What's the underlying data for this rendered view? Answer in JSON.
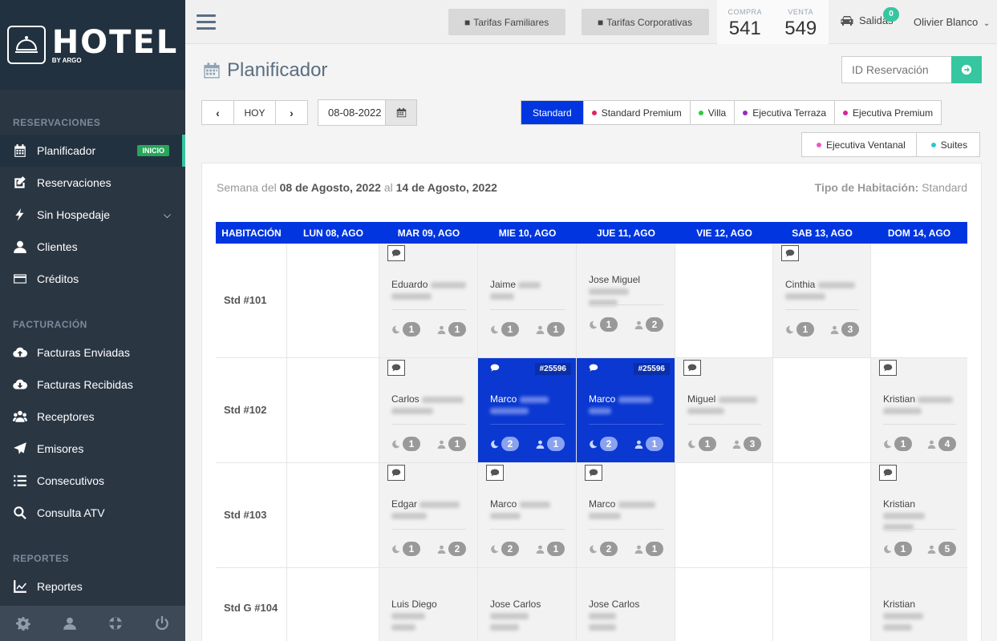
{
  "sidebar": {
    "logo": {
      "name": "HOTEL",
      "sub": "BY ARGO"
    },
    "sections": {
      "reservaciones": "RESERVACIONES",
      "facturacion": "FACTURACIÓN",
      "reportes": "REPORTES"
    },
    "items": [
      {
        "label": "Planificador",
        "icon": "calendar-icon",
        "badge": "INICIO"
      },
      {
        "label": "Reservaciones",
        "icon": "edit-icon"
      },
      {
        "label": "Sin Hospedaje",
        "icon": "bolt-icon"
      },
      {
        "label": "Clientes",
        "icon": "user-icon"
      },
      {
        "label": "Créditos",
        "icon": "credit-card-icon"
      },
      {
        "label": "Facturas Enviadas",
        "icon": "cloud-upload-icon"
      },
      {
        "label": "Facturas Recibidas",
        "icon": "cloud-download-icon"
      },
      {
        "label": "Receptores",
        "icon": "users-icon"
      },
      {
        "label": "Emisores",
        "icon": "paper-plane-icon"
      },
      {
        "label": "Consecutivos",
        "icon": "list-icon"
      },
      {
        "label": "Consulta ATV",
        "icon": "search-icon"
      },
      {
        "label": "Reportes",
        "icon": "line-chart-icon"
      }
    ]
  },
  "topbar": {
    "btn_familiares": "Tarifas Familiares",
    "btn_corporativas": "Tarifas Corporativas",
    "compra_label": "COMPRA",
    "compra_value": "541",
    "venta_label": "VENTA",
    "venta_value": "549",
    "salidas_label": "Salidas",
    "salidas_count": "0",
    "user_name": "Olivier Blanco"
  },
  "page": {
    "title": "Planificador",
    "search_placeholder": "ID Reservación",
    "today_label": "HOY",
    "date_value": "08-08-2022"
  },
  "room_types": [
    {
      "label": "Standard",
      "color": "",
      "active": true
    },
    {
      "label": "Standard Premium",
      "color": "#e0245e"
    },
    {
      "label": "Villa",
      "color": "#2ecc40"
    },
    {
      "label": "Ejecutiva Terraza",
      "color": "#9b27c2"
    },
    {
      "label": "Ejecutiva Premium",
      "color": "#d6249f"
    },
    {
      "label": "Ejecutiva Ventanal",
      "color": "#e85ac8"
    },
    {
      "label": "Suites",
      "color": "#2ec7d3"
    }
  ],
  "week": {
    "prefix": "Semana del",
    "start": "08 de Agosto, 2022",
    "mid": "al",
    "end": "14 de Agosto, 2022",
    "tipo_label": "Tipo de Habitación:",
    "tipo_value": "Standard"
  },
  "grid": {
    "headers": [
      "HABITACIÓN",
      "LUN 08, AGO",
      "MAR 09, AGO",
      "MIE 10, AGO",
      "JUE 11, AGO",
      "VIE 12, AGO",
      "SAB 13, AGO",
      "DOM 14, AGO"
    ],
    "rows": [
      {
        "room": "Std #101",
        "cells": [
          null,
          {
            "name": "Eduardo",
            "nights": "1",
            "guests": "1"
          },
          {
            "name": "Jaime",
            "nights": "1",
            "guests": "1"
          },
          {
            "name": "Jose Miguel",
            "nights": "1",
            "guests": "2"
          },
          null,
          {
            "name": "Cinthia",
            "nights": "1",
            "guests": "3"
          },
          null
        ]
      },
      {
        "room": "Std #102",
        "cells": [
          null,
          {
            "name": "Carlos",
            "nights": "1",
            "guests": "1"
          },
          {
            "name": "Marco",
            "nights": "2",
            "guests": "1",
            "id": "#25596",
            "selected": true
          },
          {
            "name": "Marco",
            "nights": "2",
            "guests": "1",
            "id": "#25596",
            "selected": true
          },
          {
            "name": "Miguel",
            "nights": "1",
            "guests": "3"
          },
          null,
          {
            "name": "Kristian",
            "nights": "1",
            "guests": "4"
          }
        ]
      },
      {
        "room": "Std #103",
        "cells": [
          null,
          {
            "name": "Edgar",
            "nights": "1",
            "guests": "2"
          },
          {
            "name": "Marco",
            "nights": "2",
            "guests": "1"
          },
          {
            "name": "Marco",
            "nights": "2",
            "guests": "1"
          },
          null,
          null,
          {
            "name": "Kristian",
            "nights": "1",
            "guests": "5"
          }
        ]
      },
      {
        "room": "Std G #104",
        "cells": [
          null,
          {
            "name": "Luis Diego"
          },
          {
            "name": "Jose Carlos"
          },
          {
            "name": "Jose Carlos"
          },
          null,
          null,
          {
            "name": "Kristian"
          }
        ]
      }
    ]
  }
}
